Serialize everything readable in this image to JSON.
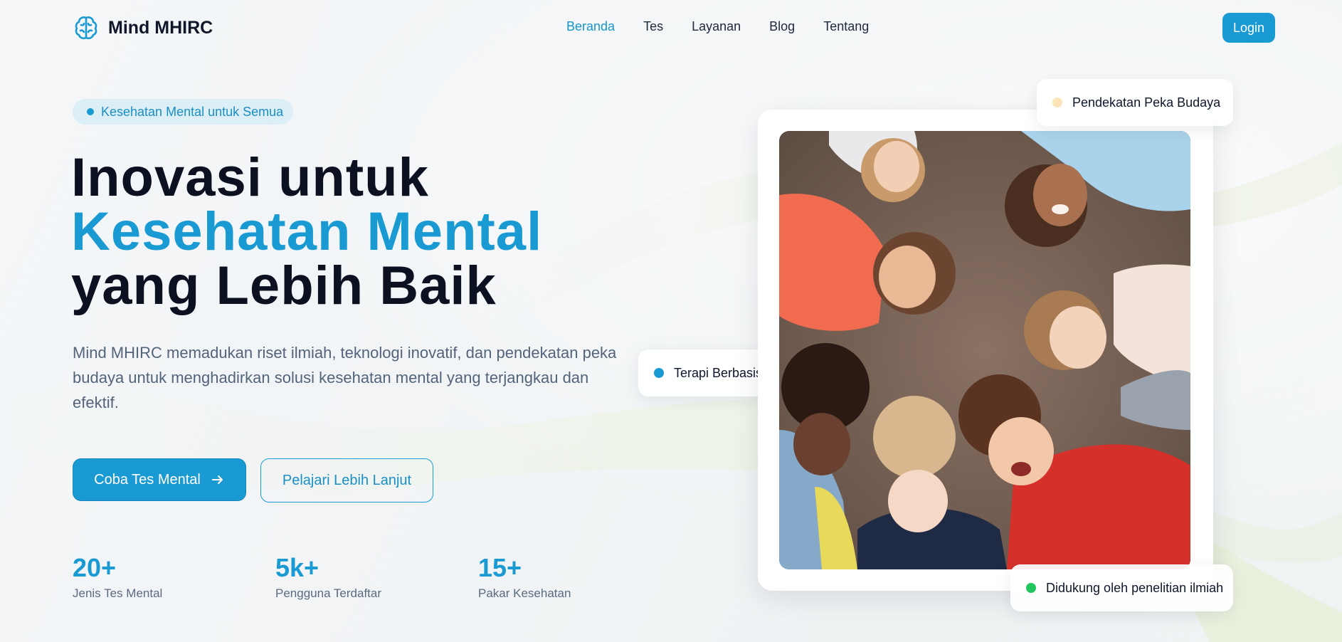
{
  "brand": {
    "name": "Mind MHIRC",
    "icon": "brain-icon"
  },
  "nav": {
    "links": [
      "Beranda",
      "Tes",
      "Layanan",
      "Blog",
      "Tentang"
    ],
    "active": "Beranda",
    "login_label": "Login"
  },
  "hero": {
    "badge": "Kesehatan Mental untuk Semua",
    "headline_line1": "Inovasi untuk",
    "headline_line2": "Kesehatan Mental",
    "headline_line3": "yang Lebih Baik",
    "description": "Mind MHIRC memadukan riset ilmiah, teknologi inovatif, dan pendekatan peka budaya untuk menghadirkan solusi kesehatan mental yang terjangkau dan efektif.",
    "primary_cta": "Coba Tes Mental",
    "primary_cta_icon": "arrow-right-icon",
    "secondary_cta": "Pelajari Lebih Lanjut"
  },
  "stats": [
    {
      "value": "20+",
      "label": "Jenis Tes Mental"
    },
    {
      "value": "5k+",
      "label": "Pengguna Terdaftar"
    },
    {
      "value": "15+",
      "label": "Pakar Kesehatan"
    }
  ],
  "floating_tags": {
    "top": {
      "text": "Pendekatan Peka Budaya",
      "dot_color": "#fde4b8"
    },
    "left": {
      "text": "Terapi Berbasis Bu",
      "dot_color": "#1a9ad2"
    },
    "bottom": {
      "text": "Didukung oleh penelitian ilmiah",
      "dot_color": "#22c55e"
    }
  },
  "colors": {
    "accent": "#1a9ad2",
    "heading": "#0b1120",
    "body_text": "#53647a"
  }
}
